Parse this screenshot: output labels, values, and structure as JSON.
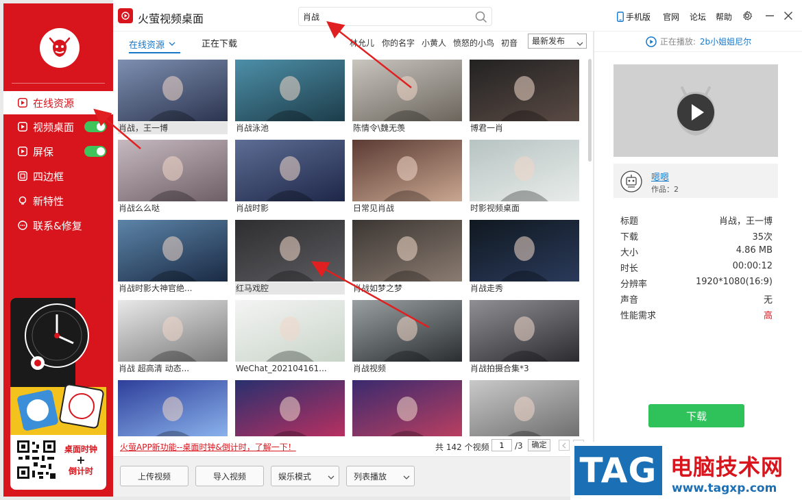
{
  "app": {
    "title": "火萤视频桌面"
  },
  "search": {
    "value": "肖战",
    "placeholder": ""
  },
  "header_links": [
    "手机版",
    "官网",
    "论坛",
    "帮助"
  ],
  "sidebar": {
    "items": [
      {
        "label": "在线资源",
        "icon": "play-icon",
        "active": true
      },
      {
        "label": "视频桌面",
        "icon": "play-icon",
        "toggle": true
      },
      {
        "label": "屏保",
        "icon": "play-icon",
        "toggle": true
      },
      {
        "label": "四边框",
        "icon": "frame-icon"
      },
      {
        "label": "新特性",
        "icon": "bulb-icon"
      },
      {
        "label": "联系&修复",
        "icon": "chat-icon"
      }
    ],
    "promo": {
      "line1": "桌面时钟",
      "plus": "+",
      "line2": "倒计时"
    }
  },
  "tabs": {
    "online": "在线资源",
    "downloading": "正在下载"
  },
  "hot_tags": [
    "林允儿",
    "你的名字",
    "小黄人",
    "愤怒的小鸟",
    "初音"
  ],
  "sort": {
    "selected": "最新发布"
  },
  "videos": [
    {
      "title": "肖战，王一博",
      "selected": true
    },
    {
      "title": "肖战泳池"
    },
    {
      "title": "陈情令\\魏无羡"
    },
    {
      "title": "博君一肖"
    },
    {
      "title": "肖战么么哒"
    },
    {
      "title": "肖战时影"
    },
    {
      "title": "日常见肖战"
    },
    {
      "title": "时影视频桌面"
    },
    {
      "title": "肖战时影大神官绝..."
    },
    {
      "title": "红马戏腔",
      "selected": true
    },
    {
      "title": "肖战如梦之梦"
    },
    {
      "title": "肖战走秀"
    },
    {
      "title": "肖战 超高清 动态..."
    },
    {
      "title": "WeChat_202104161..."
    },
    {
      "title": "肖战视频"
    },
    {
      "title": "肖战拍摄合集*3"
    },
    {
      "title": ""
    },
    {
      "title": ""
    },
    {
      "title": ""
    },
    {
      "title": ""
    }
  ],
  "pagination": {
    "promo_link": "火萤APP新功能--桌面时钟&倒计时，了解一下！",
    "total_prefix": "共",
    "total": "142",
    "total_suffix": "个视频",
    "current_page": "1",
    "total_pages": "/3",
    "confirm": "确定"
  },
  "bottom_buttons": {
    "upload": "上传视频",
    "import": "导入视频",
    "mode": "娱乐模式",
    "playlist": "列表播放"
  },
  "right_panel": {
    "now_playing_label": "正在播放:",
    "now_playing_title": "2b小姐姐尼尔",
    "author_name": "嗯嗯",
    "works_label": "作品：2",
    "info": [
      {
        "key": "标题",
        "value": "肖战，王一博"
      },
      {
        "key": "下载",
        "value": "35次"
      },
      {
        "key": "大小",
        "value": "4.86 MB"
      },
      {
        "key": "时长",
        "value": "00:00:12"
      },
      {
        "key": "分辨率",
        "value": "1920*1080(16:9)"
      },
      {
        "key": "声音",
        "value": "无"
      },
      {
        "key": "性能需求",
        "value": "高"
      }
    ],
    "download": "下载"
  },
  "watermark": {
    "tag": "TAG",
    "title": "电脑技术网",
    "url": "www.tagxp.com"
  },
  "colors": {
    "brand": "#d8141c",
    "link": "#1677c9",
    "download": "#2fc25b",
    "toggle": "#3ec45a"
  }
}
